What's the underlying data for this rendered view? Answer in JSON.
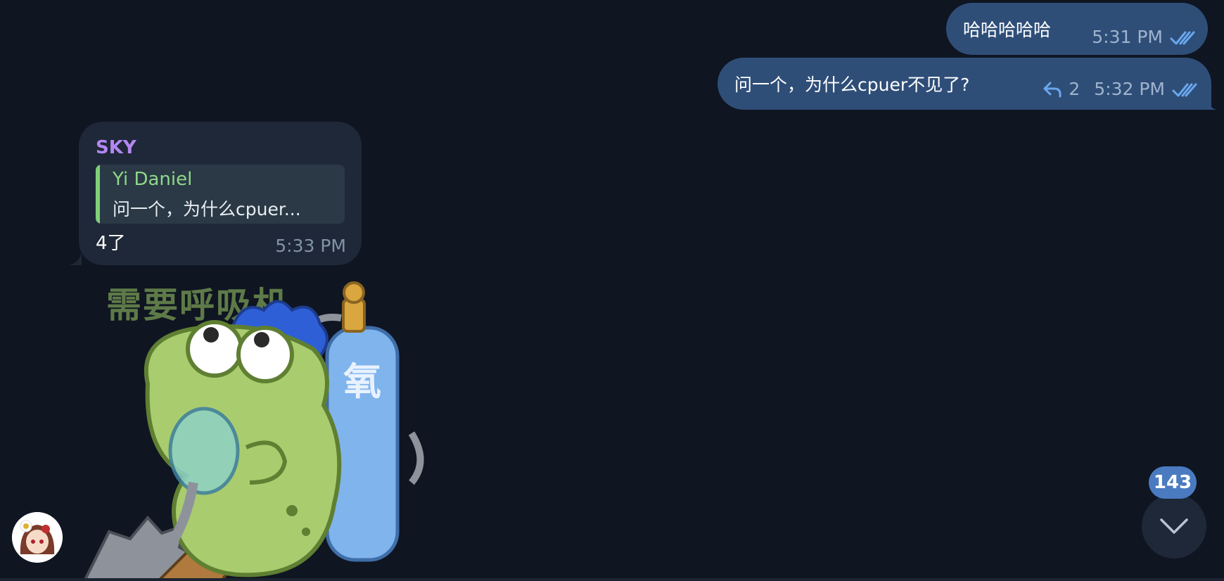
{
  "messages_out": [
    {
      "text": "哈哈哈哈哈",
      "time": "5:31 PM"
    },
    {
      "text": "问一个，为什么cpuer不见了?",
      "reply_count": "2",
      "time": "5:32 PM"
    }
  ],
  "message_in": {
    "sender": "SKY",
    "reply_to": {
      "name": "Yi Daniel",
      "text": "问一个，为什么cpuer..."
    },
    "text": "4了",
    "time": "5:33 PM"
  },
  "sticker": {
    "caption": "需要呼吸机",
    "tank_label": "氧"
  },
  "scroll_down": {
    "unread_count": "143"
  },
  "colors": {
    "background": "#0f1521",
    "outgoing_bubble": "#2e4e78",
    "incoming_bubble": "#1e2838",
    "sender_name": "#b387f0",
    "reply_accent": "#7fcf7a",
    "badge": "#4a7bc0"
  },
  "icons": [
    "double-check-icon",
    "reply-arrow-icon",
    "chevron-down-icon"
  ]
}
